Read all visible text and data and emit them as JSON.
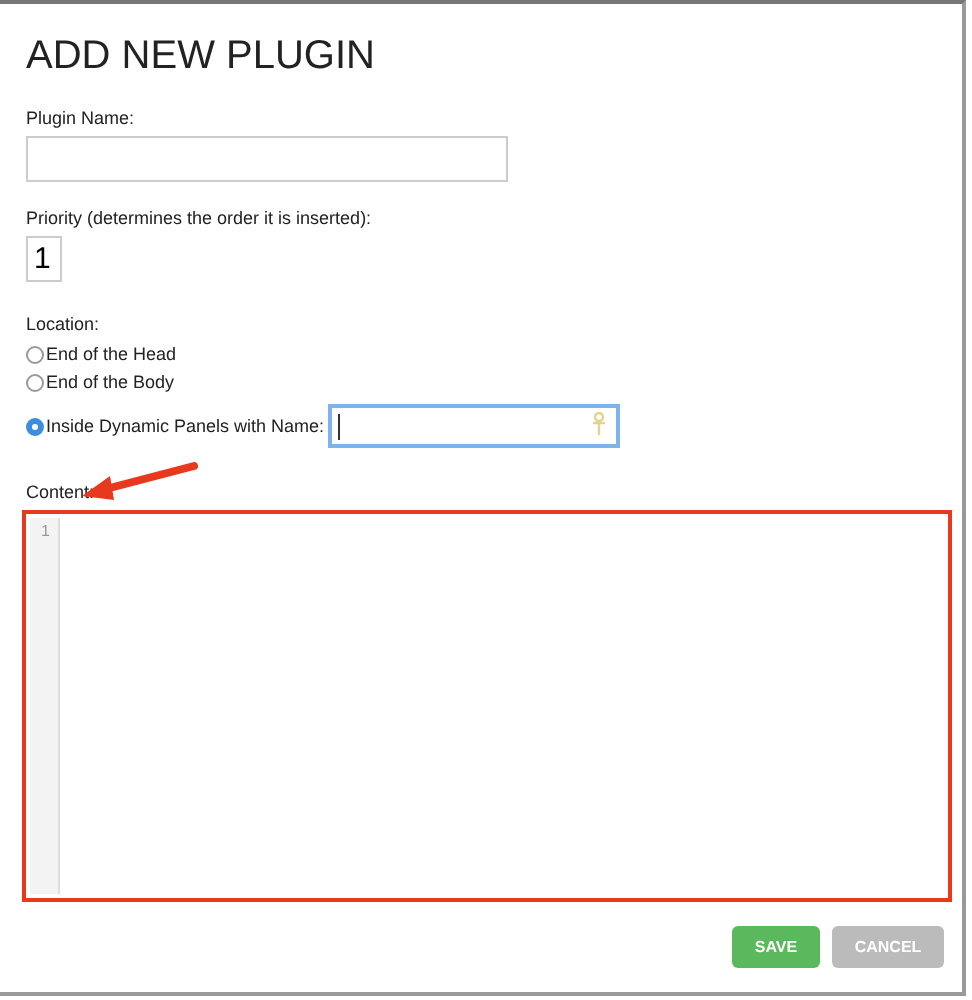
{
  "title": "ADD NEW PLUGIN",
  "plugin_name": {
    "label": "Plugin Name:"
  },
  "priority": {
    "label": "Priority (determines the order it is inserted):",
    "value": "1"
  },
  "location": {
    "label": "Location:",
    "options": [
      {
        "label": "End of the Head",
        "selected": false,
        "kind": "plain"
      },
      {
        "label": "End of the Body",
        "selected": false,
        "kind": "plain"
      },
      {
        "label": "Inside Dynamic Panels with Name:",
        "selected": true,
        "kind": "with_field"
      }
    ]
  },
  "content": {
    "label": "Content:",
    "line_numbers": [
      "1"
    ]
  },
  "buttons": [
    {
      "label": "SAVE",
      "kind": "primary"
    },
    {
      "label": "CANCEL",
      "kind": "secondary"
    }
  ]
}
